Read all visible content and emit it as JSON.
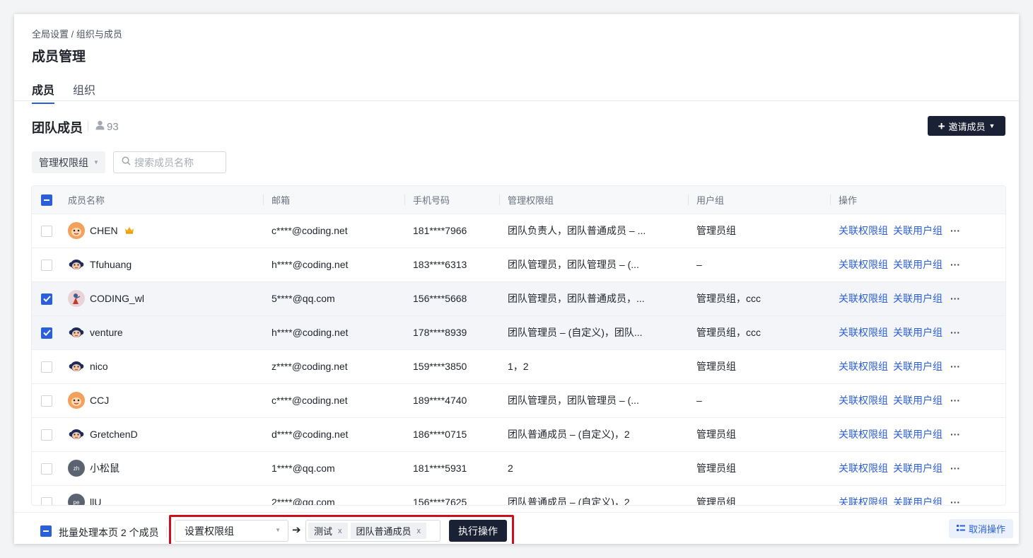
{
  "breadcrumb": "全局设置 / 组织与成员",
  "page_title": "成员管理",
  "tabs": [
    {
      "label": "成员",
      "active": true
    },
    {
      "label": "组织",
      "active": false
    }
  ],
  "section": {
    "title": "团队成员",
    "member_count": "93",
    "invite_label": "邀请成员"
  },
  "filters": {
    "group_select": "管理权限组",
    "search_placeholder": "搜索成员名称"
  },
  "table": {
    "columns": [
      "成员名称",
      "邮箱",
      "手机号码",
      "管理权限组",
      "用户组",
      "操作"
    ],
    "action_link_1": "关联权限组",
    "action_link_2": "关联用户组",
    "more": "···",
    "rows": [
      {
        "name": "CHEN",
        "email": "c****@coding.net",
        "phone": "181****7966",
        "perm": "团队负责人，团队普通成员 – ...",
        "group": "管理员组",
        "checked": false,
        "avatar": "orange-monkey-avatar",
        "crown": true
      },
      {
        "name": "Tfuhuang",
        "email": "h****@coding.net",
        "phone": "183****6313",
        "perm": "团队管理员，团队管理员 – (...",
        "group": "–",
        "checked": false,
        "avatar": "navy-monkey-avatar"
      },
      {
        "name": "CODING_wl",
        "email": "5****@qq.com",
        "phone": "156****5668",
        "perm": "团队管理员，团队普通成员，...",
        "group": "管理员组，ccc",
        "checked": true,
        "avatar": "pink-photo-avatar"
      },
      {
        "name": "venture",
        "email": "h****@coding.net",
        "phone": "178****8939",
        "perm": "团队管理员 – (自定义)，团队...",
        "group": "管理员组，ccc",
        "checked": true,
        "avatar": "navy-monkey-avatar"
      },
      {
        "name": "nico",
        "email": "z****@coding.net",
        "phone": "159****3850",
        "perm": "1，2",
        "group": "管理员组",
        "checked": false,
        "avatar": "navy-monkey-avatar"
      },
      {
        "name": "CCJ",
        "email": "c****@coding.net",
        "phone": "189****4740",
        "perm": "团队管理员，团队管理员 – (...",
        "group": "–",
        "checked": false,
        "avatar": "orange-monkey-avatar"
      },
      {
        "name": "GretchenD",
        "email": "d****@coding.net",
        "phone": "186****0715",
        "perm": "团队普通成员 – (自定义)，2",
        "group": "管理员组",
        "checked": false,
        "avatar": "navy-monkey-avatar"
      },
      {
        "name": "小松鼠",
        "email": "1****@qq.com",
        "phone": "181****5931",
        "perm": "2",
        "group": "管理员组",
        "checked": false,
        "avatar": "initials-avatar",
        "initials": "zh"
      },
      {
        "name": "llU",
        "email": "2****@qq.com",
        "phone": "156****7625",
        "perm": "团队普通成员 – (自定义)，2",
        "group": "管理员组",
        "checked": false,
        "avatar": "initials-avatar",
        "initials": "pe"
      }
    ]
  },
  "bulk": {
    "text": "批量处理本页 2 个成员",
    "operation_select": "设置权限组",
    "tags": [
      "测试",
      "团队普通成员"
    ],
    "tag_close": "x",
    "execute_label": "执行操作",
    "cancel_label": "取消操作"
  },
  "colors": {
    "primary": "#2a5fd9",
    "dark_button": "#1b2134",
    "highlight": "#c8101e"
  }
}
